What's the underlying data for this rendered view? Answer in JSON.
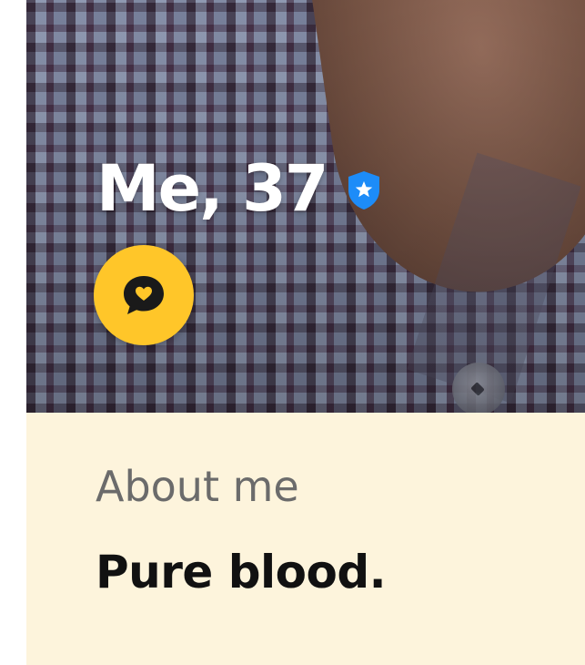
{
  "profile": {
    "name_age": "Me, 37",
    "verified_icon": "shield-star-icon",
    "compliment_icon": "chat-heart-icon"
  },
  "about": {
    "title": "About me",
    "text": "Pure blood."
  },
  "colors": {
    "accent_yellow": "#ffc629",
    "verified_blue": "#1d8cf8",
    "about_background": "#fdf4dc",
    "about_title": "#6b6b6b",
    "about_text": "#111111"
  }
}
